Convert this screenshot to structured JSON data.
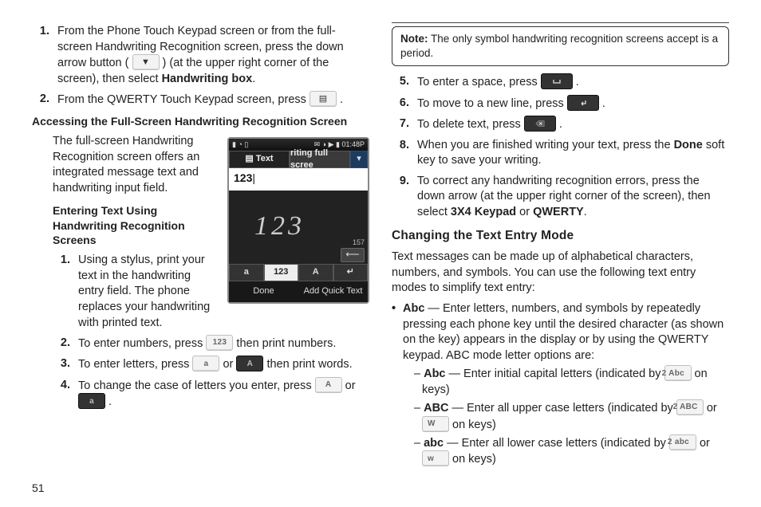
{
  "page_number": "51",
  "left": {
    "steps_a": [
      {
        "n": "1.",
        "t_before": "From the Phone Touch Keypad screen or from the full-screen Handwriting Recognition screen, press the down arrow button (",
        "t_after": ") (at the upper right corner of the screen), then select ",
        "bold": "Handwriting box",
        "t_end": "."
      },
      {
        "n": "2.",
        "t_before": "From the QWERTY Touch Keypad screen, press ",
        "t_after": " ."
      }
    ],
    "heading_a": "Accessing the Full-Screen Handwriting Recognition Screen",
    "para_a": "The full-screen Handwriting Recognition screen offers an integrated message text and handwriting input field.",
    "heading_b": "Entering Text Using Handwriting Recognition Screens",
    "steps_b": [
      {
        "n": "1.",
        "t": "Using a stylus, print your text in the handwriting entry field. The phone replaces your handwriting with printed text."
      },
      {
        "n": "2.",
        "t_before": "To enter numbers, press ",
        "key": "123",
        "t_after": " then print numbers."
      },
      {
        "n": "3.",
        "t_before": "To enter letters, press ",
        "key1": "a",
        "mid": " or ",
        "key2": "A",
        "t_after": " then print words."
      },
      {
        "n": "4.",
        "t_before": "To change the case of letters you enter, press ",
        "key1": "A",
        "mid": " or ",
        "key2": "a",
        "t_after": " ."
      }
    ],
    "phone": {
      "status_left": "▮ ◔ ▯",
      "status_right": "✉ ◑ ▶ ▮ 01:48P",
      "tab_text": "Text",
      "tab_writing": "riting full scree",
      "dd": "▾",
      "entered": "123",
      "cursor": "|",
      "hw": "123",
      "count": "157",
      "back": "⟵",
      "row": [
        "a",
        "123",
        "A",
        "↵"
      ],
      "soft_left": "Done",
      "soft_right": "Add Quick Text"
    }
  },
  "right": {
    "note_label": "Note:",
    "note_text": " The only symbol handwriting recognition screens accept is a period.",
    "steps": [
      {
        "n": "5.",
        "t_before": "To enter a space, press ",
        "icon": "space",
        "t_after": " ."
      },
      {
        "n": "6.",
        "t_before": "To move to a new line, press ",
        "icon": "enter",
        "t_after": " ."
      },
      {
        "n": "7.",
        "t_before": "To delete text, press ",
        "icon": "back",
        "t_after": " ."
      },
      {
        "n": "8.",
        "t_before": "When you are finished writing your text, press the ",
        "bold": "Done",
        "t_after": " soft key to save your writing."
      },
      {
        "n": "9.",
        "t_before": "To correct any handwriting recognition errors, press the down arrow (at the upper right corner of the screen), then select ",
        "bold": "3X4 Keypad",
        "mid": " or ",
        "bold2": "QWERTY",
        "t_after": "."
      }
    ],
    "heading": "Changing the Text Entry Mode",
    "para": "Text messages can be made up of alphabetical characters, numbers, and symbols. You can use the following text entry modes to simplify text entry:",
    "bullet": {
      "label": "Abc",
      "text": " — Enter letters, numbers, and symbols by repeatedly pressing each phone key until the desired character (as shown on the key) appears in the display or by using the QWERTY keypad. ABC mode letter options are:",
      "sub": [
        {
          "lab": "Abc",
          "txt": " — Enter initial capital letters (indicated by ",
          "k": "2 Abc",
          "tail": " on keys)"
        },
        {
          "lab": "ABC",
          "txt": " — Enter all upper case letters (indicated by ",
          "k": "2 ABC",
          "mid": " or ",
          "k2": "W",
          "tail": " on keys)"
        },
        {
          "lab": "abc",
          "txt": " — Enter all lower case letters (indicated by ",
          "k": "2 abc",
          "mid": " or ",
          "k2": "w",
          "tail": " on keys)"
        }
      ]
    }
  },
  "icons": {
    "down_arrow": "▼",
    "doc": "▤"
  }
}
